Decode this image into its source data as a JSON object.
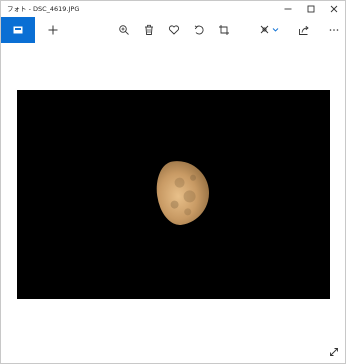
{
  "window": {
    "title": "フォト - DSC_4619.JPG"
  },
  "toolbar": {
    "items": [
      {
        "name": "collection-icon",
        "active": true
      },
      {
        "name": "add-icon"
      },
      {
        "name": "zoom-icon"
      },
      {
        "name": "delete-icon"
      },
      {
        "name": "favorite-icon"
      },
      {
        "name": "rotate-icon"
      },
      {
        "name": "crop-icon"
      },
      {
        "name": "edit-icon"
      },
      {
        "name": "share-icon"
      },
      {
        "name": "more-icon"
      }
    ]
  },
  "image": {
    "subject": "half moon"
  },
  "colors": {
    "accent": "#0a6fd4",
    "photo_bg": "#000000",
    "moon": "#d9ad78"
  }
}
